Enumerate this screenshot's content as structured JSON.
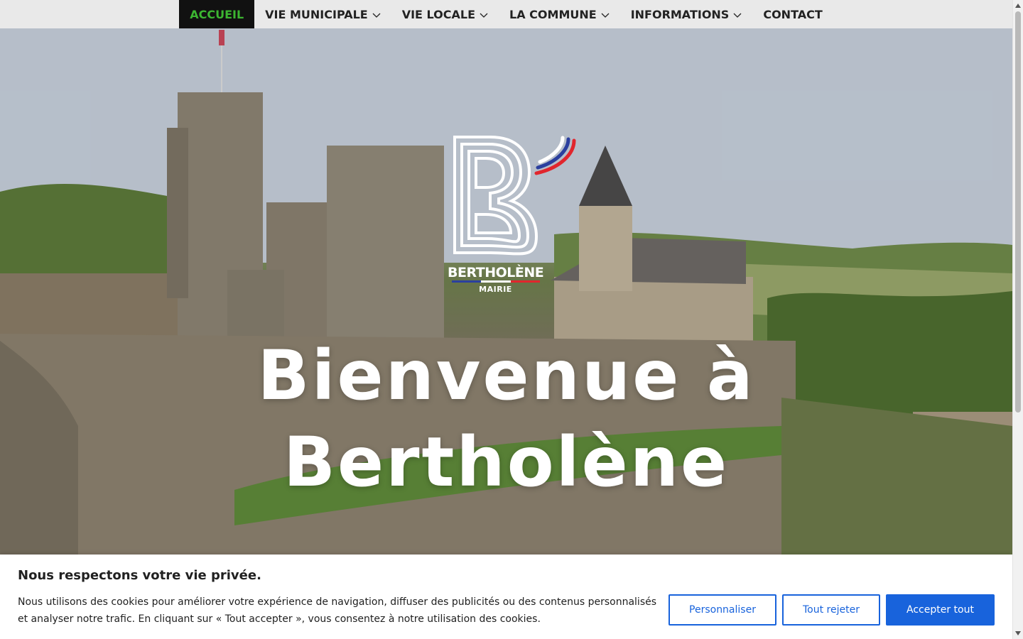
{
  "nav": {
    "items": [
      {
        "label": "ACCUEIL",
        "active": true,
        "dropdown": false
      },
      {
        "label": "VIE MUNICIPALE",
        "active": false,
        "dropdown": true
      },
      {
        "label": "VIE LOCALE",
        "active": false,
        "dropdown": true
      },
      {
        "label": "LA COMMUNE",
        "active": false,
        "dropdown": true
      },
      {
        "label": "INFORMATIONS",
        "active": false,
        "dropdown": true
      },
      {
        "label": "CONTACT",
        "active": false,
        "dropdown": false
      }
    ],
    "active_color": "#3cb531"
  },
  "logo": {
    "name": "BERTHOLÈNE",
    "subtitle": "MAIRIE"
  },
  "hero": {
    "title_line1": "Bienvenue à",
    "title_line2": "Bertholène"
  },
  "cookie": {
    "title": "Nous respectons votre vie privée.",
    "text": "Nous utilisons des cookies pour améliorer votre expérience de navigation, diffuser des publicités ou des contenus personnalisés et analyser notre trafic. En cliquant sur « Tout accepter », vous consentez à notre utilisation des cookies.",
    "buttons": {
      "customize": "Personnaliser",
      "reject": "Tout rejeter",
      "accept": "Accepter tout"
    },
    "accent_color": "#1863dc"
  }
}
